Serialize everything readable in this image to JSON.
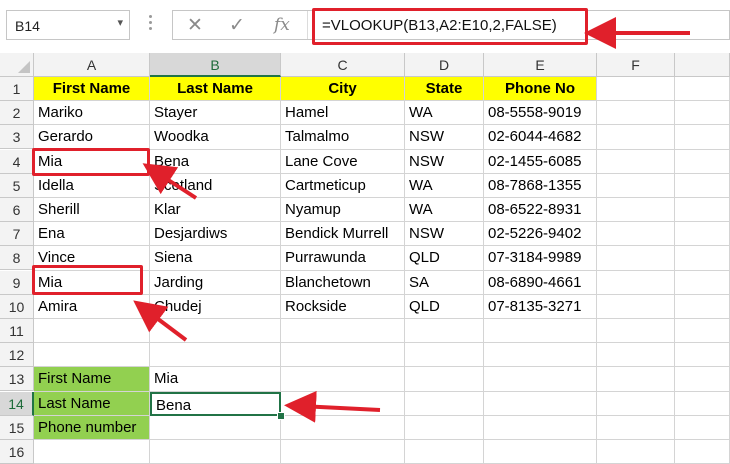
{
  "namebox": {
    "value": "B14",
    "dropdown_icon": "▾"
  },
  "formula_bar": {
    "cancel_icon": "✕",
    "enter_icon": "✓",
    "fx_label": "fx",
    "formula": "=VLOOKUP(B13,A2:E10,2,FALSE)"
  },
  "columns": [
    "A",
    "B",
    "C",
    "D",
    "E",
    "F"
  ],
  "rows": [
    "1",
    "2",
    "3",
    "4",
    "5",
    "6",
    "7",
    "8",
    "9",
    "10",
    "11",
    "12",
    "13",
    "14",
    "15",
    "16"
  ],
  "table": {
    "headers": [
      "First Name",
      "Last Name",
      "City",
      "State",
      "Phone No"
    ],
    "data": [
      [
        "Mariko",
        "Stayer",
        "Hamel",
        "WA",
        "08-5558-9019"
      ],
      [
        "Gerardo",
        "Woodka",
        "Talmalmo",
        "NSW",
        "02-6044-4682"
      ],
      [
        "Mia",
        "Bena",
        "Lane Cove",
        "NSW",
        "02-1455-6085"
      ],
      [
        "Idella",
        "Scotland",
        "Cartmeticup",
        "WA",
        "08-7868-1355"
      ],
      [
        "Sherill",
        "Klar",
        "Nyamup",
        "WA",
        "08-6522-8931"
      ],
      [
        "Ena",
        "Desjardiws",
        "Bendick Murrell",
        "NSW",
        "02-5226-9402"
      ],
      [
        "Vince",
        "Siena",
        "Purrawunda",
        "QLD",
        "07-3184-9989"
      ],
      [
        "Mia",
        "Jarding",
        "Blanchetown",
        "SA",
        "08-6890-4661"
      ],
      [
        "Amira",
        "Chudej",
        "Rockside",
        "QLD",
        "07-8135-3271"
      ]
    ]
  },
  "lookup": {
    "labels": [
      "First Name",
      "Last Name",
      "Phone number"
    ],
    "values": [
      "Mia",
      "Bena",
      ""
    ]
  },
  "selected_cell": "B14",
  "colors": {
    "header_fill": "#ffff00",
    "label_fill": "#92d050",
    "highlight": "#e0202b",
    "selection": "#217346"
  }
}
